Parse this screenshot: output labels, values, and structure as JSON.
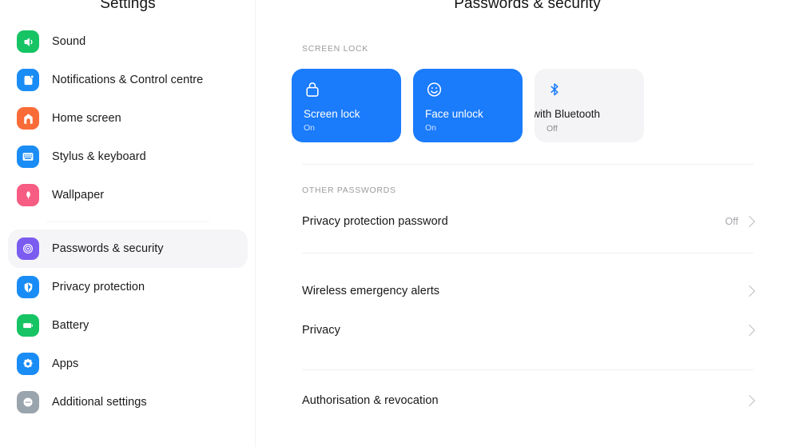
{
  "sidebar": {
    "title": "Settings",
    "items": [
      {
        "label": "Sound",
        "icon": "sound-icon",
        "color": "#16c464",
        "selected": false
      },
      {
        "label": "Notifications & Control centre",
        "icon": "notifications-icon",
        "color": "#1a8cf5",
        "selected": false
      },
      {
        "label": "Home screen",
        "icon": "home-icon",
        "color": "#f96b37",
        "selected": false
      },
      {
        "label": "Stylus & keyboard",
        "icon": "keyboard-icon",
        "color": "#1a8cf5",
        "selected": false
      },
      {
        "label": "Wallpaper",
        "icon": "wallpaper-icon",
        "color": "#f75c82",
        "selected": false
      },
      {
        "label": "Passwords & security",
        "icon": "fingerprint-icon",
        "color": "#7b5cf0",
        "selected": true
      },
      {
        "label": "Privacy protection",
        "icon": "privacy-icon",
        "color": "#1a8cf5",
        "selected": false
      },
      {
        "label": "Battery",
        "icon": "battery-icon",
        "color": "#16c464",
        "selected": false
      },
      {
        "label": "Apps",
        "icon": "apps-icon",
        "color": "#1a8cf5",
        "selected": false
      },
      {
        "label": "Additional settings",
        "icon": "more-icon",
        "color": "#9aa4ad",
        "selected": false
      }
    ]
  },
  "main": {
    "title": "Passwords & security",
    "screen_lock": {
      "label": "SCREEN LOCK",
      "cards": [
        {
          "title": "Screen lock",
          "status": "On",
          "icon": "lock-icon",
          "style": "blue"
        },
        {
          "title": "Face unlock",
          "status": "On",
          "icon": "face-icon",
          "style": "blue"
        },
        {
          "title": "ck with Bluetooth",
          "status": "Off",
          "icon": "bluetooth-icon",
          "style": "grey"
        }
      ]
    },
    "other_passwords": {
      "label": "OTHER PASSWORDS",
      "rows": [
        {
          "label": "Privacy protection password",
          "value": "Off",
          "chevron": true
        },
        {
          "label": "Wireless emergency alerts",
          "value": "",
          "chevron": true
        },
        {
          "label": "Privacy",
          "value": "",
          "chevron": true
        },
        {
          "label": "Authorisation & revocation",
          "value": "",
          "chevron": true
        }
      ]
    }
  },
  "colors": {
    "accent_blue": "#1a7bfb",
    "card_grey": "#f4f4f6",
    "selected_row": "#f5f5f7",
    "muted_text": "#9b9b9f"
  }
}
